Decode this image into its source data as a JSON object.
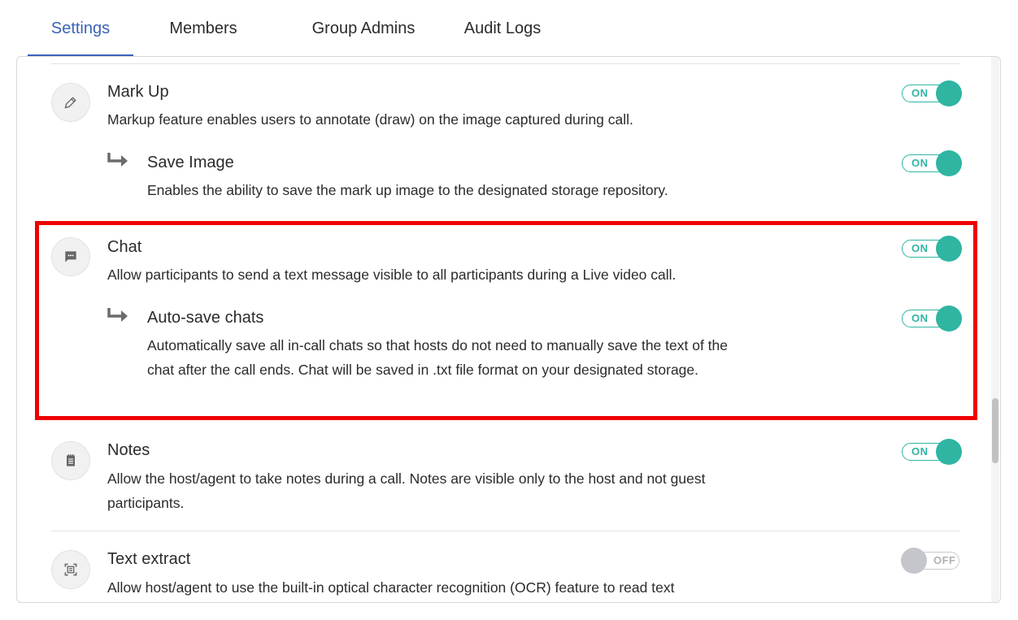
{
  "tabs": [
    {
      "label": "Settings",
      "active": true
    },
    {
      "label": "Members",
      "active": false
    },
    {
      "label": "Group Admins",
      "active": false
    },
    {
      "label": "Audit Logs",
      "active": false
    }
  ],
  "features": {
    "markup": {
      "title": "Mark Up",
      "description": "Markup feature enables users to annotate (draw) on the image captured during call.",
      "icon": "pencil-icon",
      "toggle": "ON"
    },
    "save_image": {
      "title": "Save Image",
      "description": "Enables the ability to save the mark up image to the designated storage repository.",
      "toggle": "ON"
    },
    "chat": {
      "title": "Chat",
      "description": "Allow participants to send a text message visible to all participants during a Live video call.",
      "icon": "chat-icon",
      "toggle": "ON"
    },
    "auto_save_chats": {
      "title": "Auto-save chats",
      "description": "Automatically save all in-call chats so that hosts do not need to manually save the text of the chat after the call ends. Chat will be saved in .txt file format on your designated storage.",
      "toggle": "ON"
    },
    "notes": {
      "title": "Notes",
      "description": "Allow the host/agent to take notes during a call. Notes are visible only to the host and not guest participants.",
      "icon": "notepad-icon",
      "toggle": "ON"
    },
    "text_extract": {
      "title": "Text extract",
      "description": "Allow host/agent to use the built-in optical character recognition (OCR) feature to read text",
      "icon": "text-scan-icon",
      "toggle": "OFF"
    }
  },
  "colors": {
    "accent": "#3a63b8",
    "toggle_on": "#2fb5a2",
    "toggle_off": "#c4c6cc",
    "highlight": "#ee0000"
  }
}
